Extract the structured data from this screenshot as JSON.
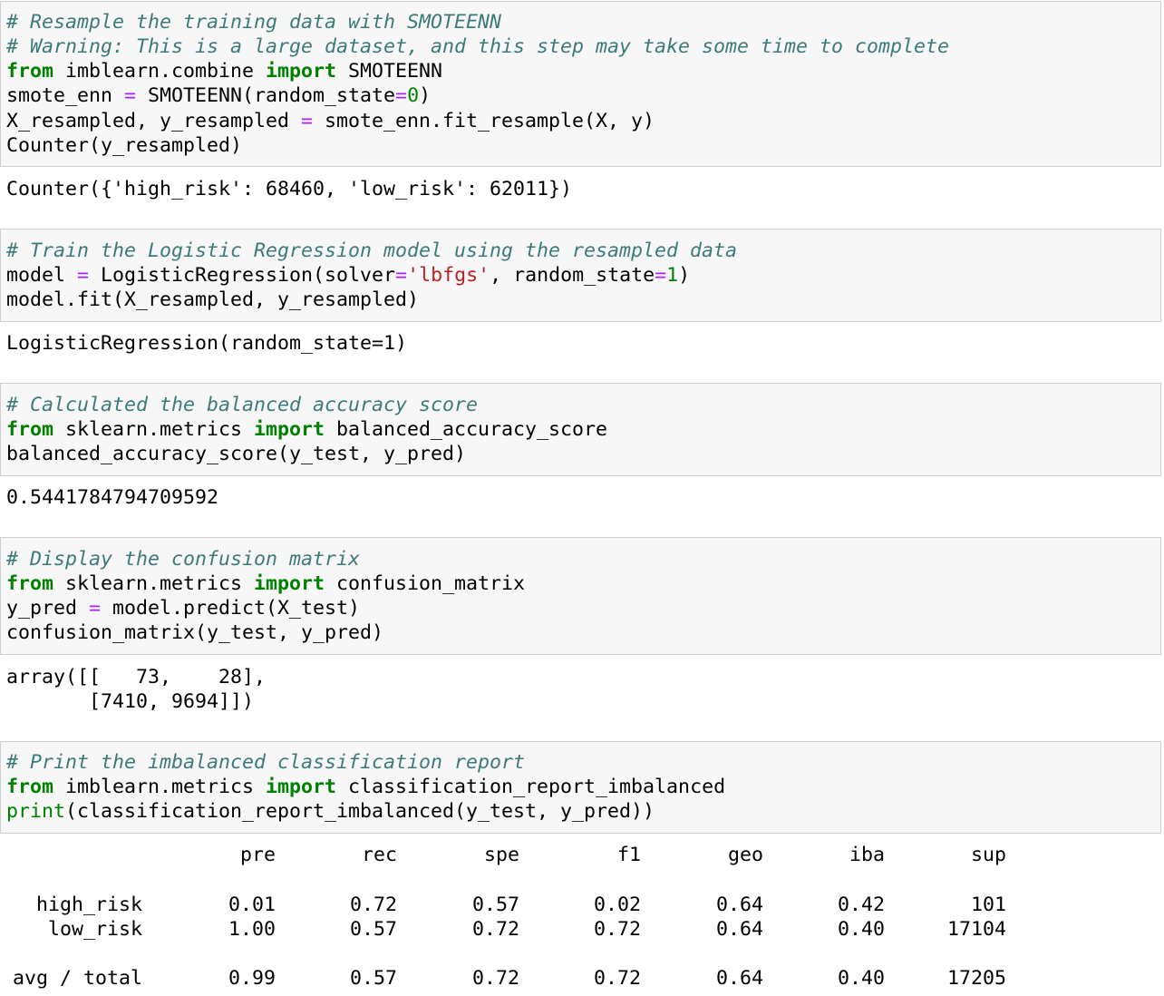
{
  "cells": [
    {
      "input": [
        [
          [
            "cm",
            "# Resample the training data with SMOTEENN"
          ]
        ],
        [
          [
            "cm",
            "# Warning: This is a large dataset, and this step may take some time to complete"
          ]
        ],
        [
          [
            "kw",
            "from"
          ],
          [
            "",
            " imblearn.combine "
          ],
          [
            "kw",
            "import"
          ],
          [
            "",
            " SMOTEENN"
          ]
        ],
        [
          [
            "",
            "smote_enn "
          ],
          [
            "op",
            "="
          ],
          [
            "",
            " SMOTEENN(random_state"
          ],
          [
            "op",
            "="
          ],
          [
            "num",
            "0"
          ],
          [
            "",
            ")"
          ]
        ],
        [
          [
            "",
            "X_resampled, y_resampled "
          ],
          [
            "op",
            "="
          ],
          [
            "",
            " smote_enn.fit_resample(X, y)"
          ]
        ],
        [
          [
            "",
            "Counter(y_resampled)"
          ]
        ]
      ],
      "output": "Counter({'high_risk': 68460, 'low_risk': 62011})"
    },
    {
      "input": [
        [
          [
            "cm",
            "# Train the Logistic Regression model using the resampled data"
          ]
        ],
        [
          [
            "",
            "model "
          ],
          [
            "op",
            "="
          ],
          [
            "",
            " LogisticRegression(solver"
          ],
          [
            "op",
            "="
          ],
          [
            "str",
            "'lbfgs'"
          ],
          [
            "",
            ", random_state"
          ],
          [
            "op",
            "="
          ],
          [
            "num",
            "1"
          ],
          [
            "",
            ")"
          ]
        ],
        [
          [
            "",
            "model.fit(X_resampled, y_resampled)"
          ]
        ]
      ],
      "output": "LogisticRegression(random_state=1)"
    },
    {
      "input": [
        [
          [
            "cm",
            "# Calculated the balanced accuracy score"
          ]
        ],
        [
          [
            "kw",
            "from"
          ],
          [
            "",
            " sklearn.metrics "
          ],
          [
            "kw",
            "import"
          ],
          [
            "",
            " balanced_accuracy_score"
          ]
        ],
        [
          [
            "",
            "balanced_accuracy_score(y_test, y_pred)"
          ]
        ]
      ],
      "output": "0.5441784794709592"
    },
    {
      "input": [
        [
          [
            "cm",
            "# Display the confusion matrix"
          ]
        ],
        [
          [
            "kw",
            "from"
          ],
          [
            "",
            " sklearn.metrics "
          ],
          [
            "kw",
            "import"
          ],
          [
            "",
            " confusion_matrix"
          ]
        ],
        [
          [
            "",
            "y_pred "
          ],
          [
            "op",
            "="
          ],
          [
            "",
            " model.predict(X_test)"
          ]
        ],
        [
          [
            "",
            "confusion_matrix(y_test, y_pred)"
          ]
        ]
      ],
      "output": "array([[   73,    28],\n       [7410, 9694]])"
    },
    {
      "input": [
        [
          [
            "cm",
            "# Print the imbalanced classification report"
          ]
        ],
        [
          [
            "kw",
            "from"
          ],
          [
            "",
            " imblearn.metrics "
          ],
          [
            "kw",
            "import"
          ],
          [
            "",
            " classification_report_imbalanced"
          ]
        ],
        [
          [
            "bi",
            "print"
          ],
          [
            "",
            "(classification_report_imbalanced(y_test, y_pred))"
          ]
        ]
      ]
    }
  ],
  "report": {
    "columns": [
      "pre",
      "rec",
      "spe",
      "f1",
      "geo",
      "iba",
      "sup"
    ],
    "rows": [
      {
        "label": "high_risk",
        "values": [
          "0.01",
          "0.72",
          "0.57",
          "0.02",
          "0.64",
          "0.42",
          "101"
        ]
      },
      {
        "label": "low_risk",
        "values": [
          "1.00",
          "0.57",
          "0.72",
          "0.72",
          "0.64",
          "0.40",
          "17104"
        ]
      },
      {
        "label": "avg / total",
        "values": [
          "0.99",
          "0.57",
          "0.72",
          "0.72",
          "0.64",
          "0.40",
          "17205"
        ]
      }
    ]
  }
}
